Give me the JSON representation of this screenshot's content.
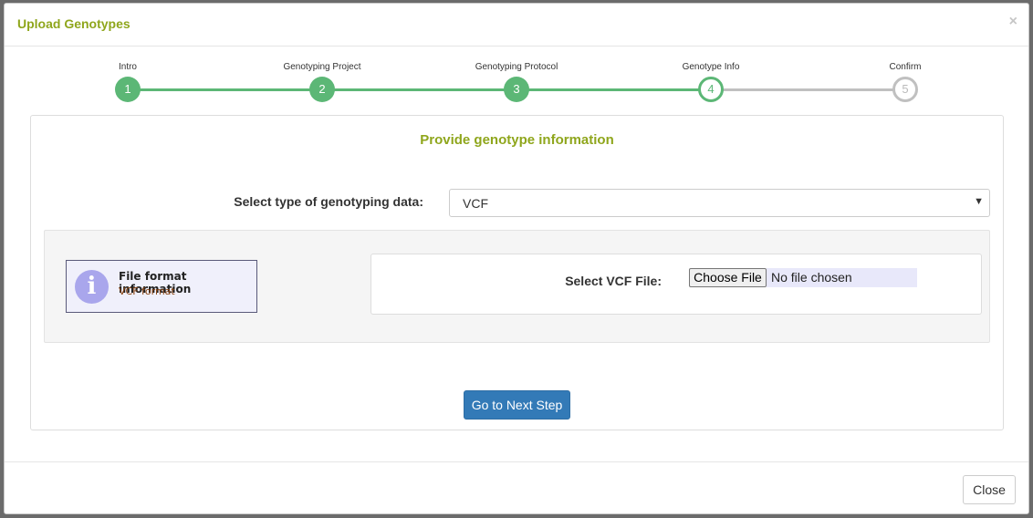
{
  "modal": {
    "title": "Upload Genotypes",
    "close_glyph": "×"
  },
  "stepper": {
    "steps": [
      {
        "label": "Intro",
        "number": "1",
        "state": "done"
      },
      {
        "label": "Genotyping Project",
        "number": "2",
        "state": "done"
      },
      {
        "label": "Genotyping Protocol",
        "number": "3",
        "state": "done"
      },
      {
        "label": "Genotype Info",
        "number": "4",
        "state": "active"
      },
      {
        "label": "Confirm",
        "number": "5",
        "state": "pending"
      }
    ],
    "colors": {
      "done": "#5cb776",
      "pending": "#c0c0c0"
    }
  },
  "panel": {
    "heading": "Provide genotype information",
    "type_label": "Select type of genotyping data:",
    "type_value": "VCF",
    "info_title": "File format information",
    "info_subtitle": "VCF format",
    "file_label": "Select VCF File:",
    "file_button": "Choose File",
    "file_status": "No file chosen",
    "next_button": "Go to Next Step"
  },
  "footer": {
    "close_button": "Close"
  },
  "colors": {
    "accent": "#8fa61c",
    "primary_button": "#337ab7"
  }
}
